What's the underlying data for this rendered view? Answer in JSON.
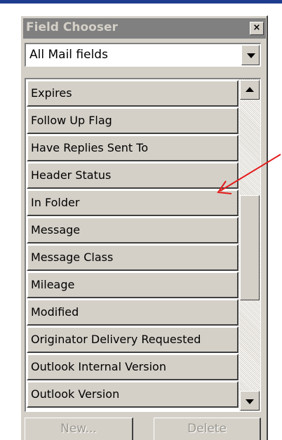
{
  "window": {
    "title": "Field Chooser",
    "close_glyph": "×"
  },
  "dropdown": {
    "value": "All Mail fields"
  },
  "fields": [
    "Expires",
    "Follow Up Flag",
    "Have Replies Sent To",
    "Header Status",
    "In Folder",
    "Message",
    "Message Class",
    "Mileage",
    "Modified",
    "Originator Delivery Requested",
    "Outlook Internal Version",
    "Outlook Version"
  ],
  "buttons": {
    "new": "New...",
    "delete": "Delete"
  },
  "annotation": {
    "color": "#e31b1b",
    "icon": "red-arrow-annotation"
  },
  "colors": {
    "titlebar": "#808080",
    "face": "#d4d0c8",
    "accent_top": "#1f3d8f"
  }
}
